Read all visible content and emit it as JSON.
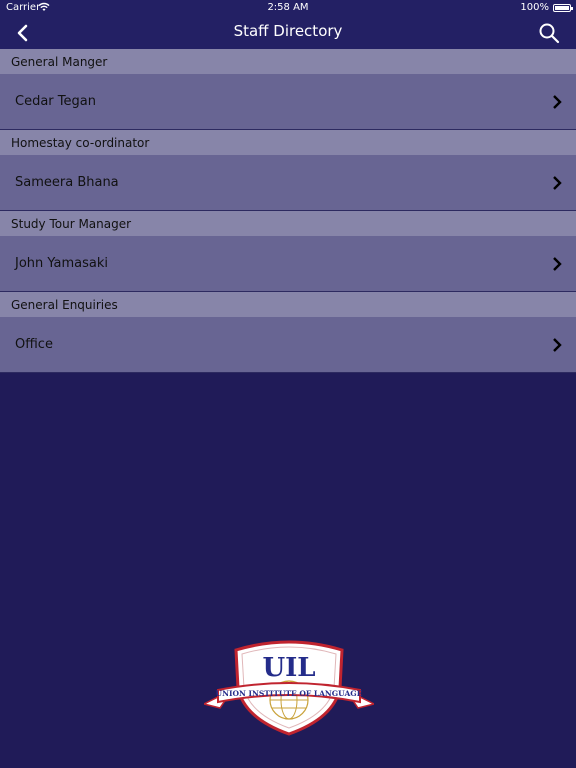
{
  "status_bar": {
    "carrier": "Carrier",
    "time": "2:58 AM",
    "battery": "100%"
  },
  "nav": {
    "title": "Staff Directory",
    "back_icon": "chevron-left-icon",
    "search_icon": "search-icon"
  },
  "sections": [
    {
      "header": "General Manger",
      "item": "Cedar Tegan"
    },
    {
      "header": "Homestay co-ordinator",
      "item": "Sameera Bhana"
    },
    {
      "header": "Study Tour Manager",
      "item": "John Yamasaki"
    },
    {
      "header": "General Enquiries",
      "item": "Office"
    }
  ],
  "logo": {
    "letters": "UIL",
    "banner": "UNION INSTITUTE OF LANGUAGE"
  },
  "colors": {
    "background": "#201b58",
    "nav": "#232064",
    "section_header": "#8785a9",
    "row": "#686593"
  }
}
